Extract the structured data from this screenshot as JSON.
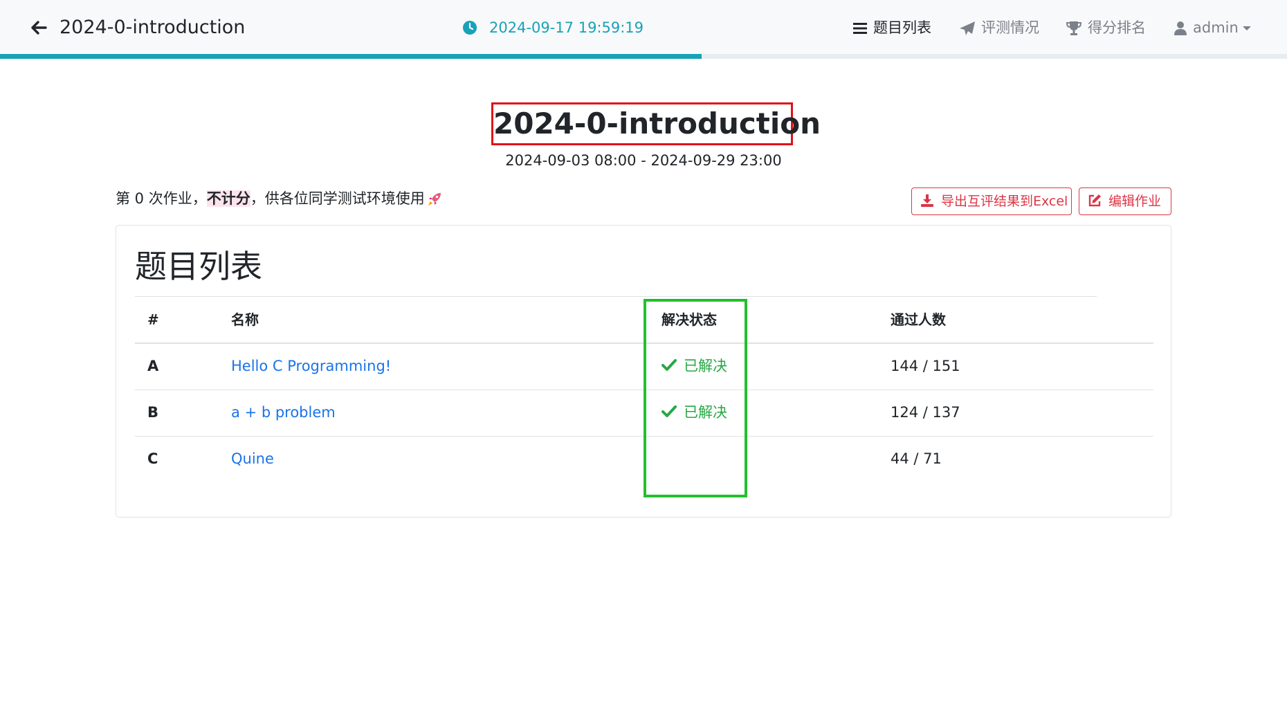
{
  "navbar": {
    "title": "2024-0-introduction",
    "time": "2024-09-17 19:59:19",
    "items": [
      {
        "label": "题目列表",
        "icon": "list-icon"
      },
      {
        "label": "评测情况",
        "icon": "paper-plane-icon"
      },
      {
        "label": "得分排名",
        "icon": "trophy-icon"
      },
      {
        "label": "admin",
        "icon": "user-icon"
      }
    ],
    "progress_fraction": 0.545,
    "accent_color": "#17a2b8"
  },
  "contest": {
    "title": "2024-0-introduction",
    "range": "2024-09-03 08:00 - 2024-09-29 23:00",
    "desc_prefix": "第 0 次作业，",
    "desc_highlight": "不计分",
    "desc_suffix": "，供各位同学测试环境使用"
  },
  "actions": {
    "export_label": "导出互评结果到Excel",
    "edit_label": "编辑作业",
    "color": "#dc3545"
  },
  "problems": {
    "title": "题目列表",
    "columns": [
      "#",
      "名称",
      "解决状态",
      "通过人数"
    ],
    "rows": [
      {
        "id": "A",
        "name": "Hello C Programming!",
        "status": "已解决",
        "passed": "144 / 151"
      },
      {
        "id": "B",
        "name": "a + b problem",
        "status": "已解决",
        "passed": "124 / 137"
      },
      {
        "id": "C",
        "name": "Quine",
        "status": "",
        "passed": "44 / 71"
      }
    ]
  }
}
